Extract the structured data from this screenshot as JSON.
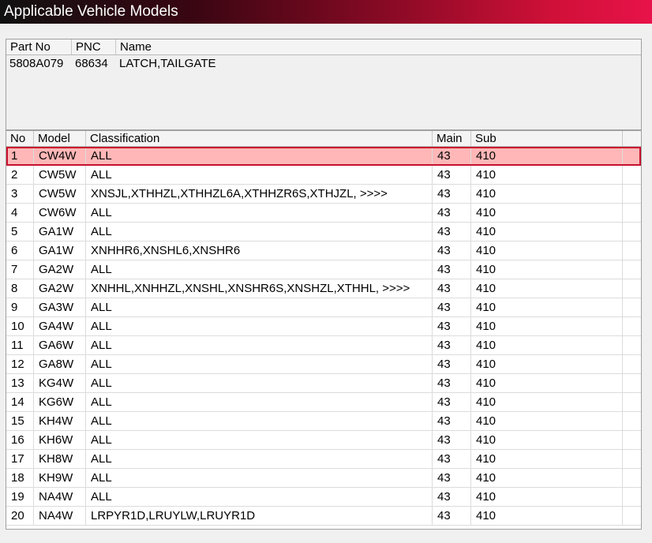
{
  "window": {
    "title": "Applicable Vehicle Models"
  },
  "part": {
    "headers": {
      "part_no": "Part No",
      "pnc": "PNC",
      "name": "Name"
    },
    "row": {
      "part_no": "5808A079",
      "pnc": "68634",
      "name": "LATCH,TAILGATE"
    }
  },
  "models": {
    "headers": {
      "no": "No",
      "model": "Model",
      "classification": "Classification",
      "main": "Main",
      "sub": "Sub"
    },
    "selected_index": 0,
    "rows": [
      {
        "no": "1",
        "model": "CW4W",
        "classification": "ALL",
        "main": "43",
        "sub": "410"
      },
      {
        "no": "2",
        "model": "CW5W",
        "classification": "ALL",
        "main": "43",
        "sub": "410"
      },
      {
        "no": "3",
        "model": "CW5W",
        "classification": "XNSJL,XTHHZL,XTHHZL6A,XTHHZR6S,XTHJZL,  >>>>",
        "main": "43",
        "sub": "410"
      },
      {
        "no": "4",
        "model": "CW6W",
        "classification": "ALL",
        "main": "43",
        "sub": "410"
      },
      {
        "no": "5",
        "model": "GA1W",
        "classification": "ALL",
        "main": "43",
        "sub": "410"
      },
      {
        "no": "6",
        "model": "GA1W",
        "classification": "XNHHR6,XNSHL6,XNSHR6",
        "main": "43",
        "sub": "410"
      },
      {
        "no": "7",
        "model": "GA2W",
        "classification": "ALL",
        "main": "43",
        "sub": "410"
      },
      {
        "no": "8",
        "model": "GA2W",
        "classification": "XNHHL,XNHHZL,XNSHL,XNSHR6S,XNSHZL,XTHHL,  >>>>",
        "main": "43",
        "sub": "410"
      },
      {
        "no": "9",
        "model": "GA3W",
        "classification": "ALL",
        "main": "43",
        "sub": "410"
      },
      {
        "no": "10",
        "model": "GA4W",
        "classification": "ALL",
        "main": "43",
        "sub": "410"
      },
      {
        "no": "11",
        "model": "GA6W",
        "classification": "ALL",
        "main": "43",
        "sub": "410"
      },
      {
        "no": "12",
        "model": "GA8W",
        "classification": "ALL",
        "main": "43",
        "sub": "410"
      },
      {
        "no": "13",
        "model": "KG4W",
        "classification": "ALL",
        "main": "43",
        "sub": "410"
      },
      {
        "no": "14",
        "model": "KG6W",
        "classification": "ALL",
        "main": "43",
        "sub": "410"
      },
      {
        "no": "15",
        "model": "KH4W",
        "classification": "ALL",
        "main": "43",
        "sub": "410"
      },
      {
        "no": "16",
        "model": "KH6W",
        "classification": "ALL",
        "main": "43",
        "sub": "410"
      },
      {
        "no": "17",
        "model": "KH8W",
        "classification": "ALL",
        "main": "43",
        "sub": "410"
      },
      {
        "no": "18",
        "model": "KH9W",
        "classification": "ALL",
        "main": "43",
        "sub": "410"
      },
      {
        "no": "19",
        "model": "NA4W",
        "classification": "ALL",
        "main": "43",
        "sub": "410"
      },
      {
        "no": "20",
        "model": "NA4W",
        "classification": "LRPYR1D,LRUYLW,LRUYR1D",
        "main": "43",
        "sub": "410"
      }
    ]
  }
}
